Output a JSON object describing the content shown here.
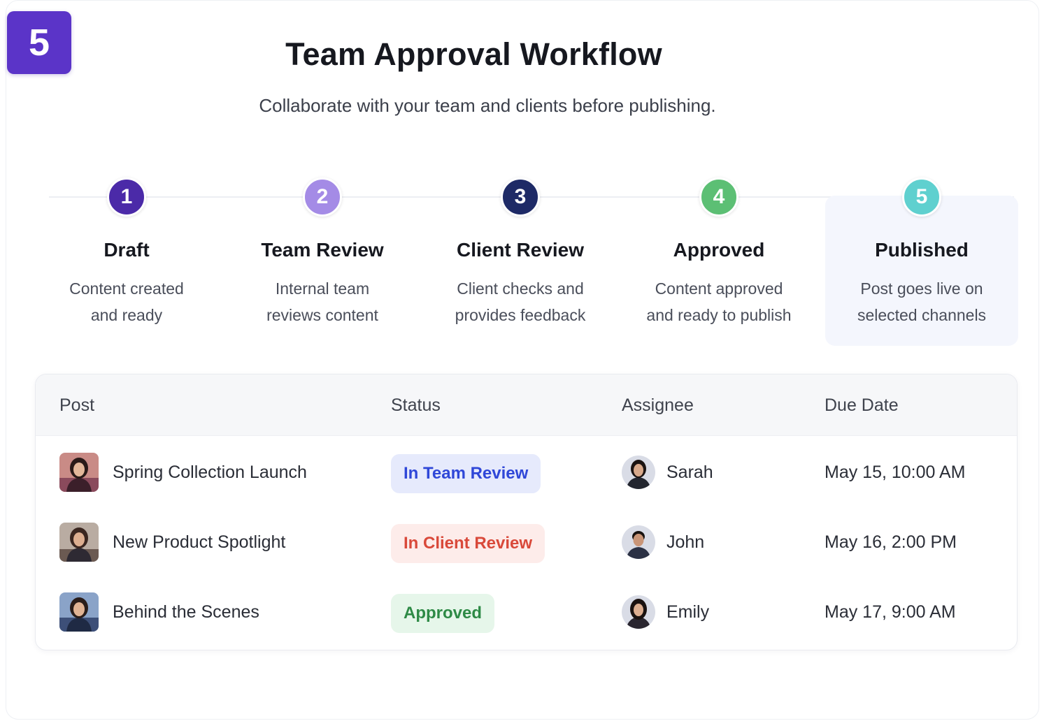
{
  "badge": "5",
  "header": {
    "title": "Team Approval Workflow",
    "subtitle": "Collaborate with your team and clients before publishing."
  },
  "steps": [
    {
      "number": "1",
      "title": "Draft",
      "description": "Content created\nand ready",
      "color": "#4b2aa8"
    },
    {
      "number": "2",
      "title": "Team Review",
      "description": "Internal team\nreviews content",
      "color": "#a48be6"
    },
    {
      "number": "3",
      "title": "Client Review",
      "description": "Client checks and\nprovides feedback",
      "color": "#1e2a66"
    },
    {
      "number": "4",
      "title": "Approved",
      "description": "Content approved\nand ready to publish",
      "color": "#5cbf74"
    },
    {
      "number": "5",
      "title": "Published",
      "description": "Post goes live on\nselected channels",
      "color": "#5fd0cf"
    }
  ],
  "table": {
    "columns": [
      "Post",
      "Status",
      "Assignee",
      "Due Date"
    ],
    "rows": [
      {
        "post": "Spring Collection Launch",
        "status": "In Team Review",
        "assignee": "Sarah",
        "due": "May 15, 10:00 AM"
      },
      {
        "post": "New Product Spotlight",
        "status": "In Client Review",
        "assignee": "John",
        "due": "May 16, 2:00 PM"
      },
      {
        "post": "Behind the Scenes",
        "status": "Approved",
        "assignee": "Emily",
        "due": "May 17, 9:00 AM"
      }
    ]
  },
  "status_colors": {
    "In Team Review": {
      "bg": "#e6eafc",
      "fg": "#2f47d8"
    },
    "In Client Review": {
      "bg": "#fdecea",
      "fg": "#d9493a"
    },
    "Approved": {
      "bg": "#e6f6ea",
      "fg": "#2e8a46"
    }
  }
}
